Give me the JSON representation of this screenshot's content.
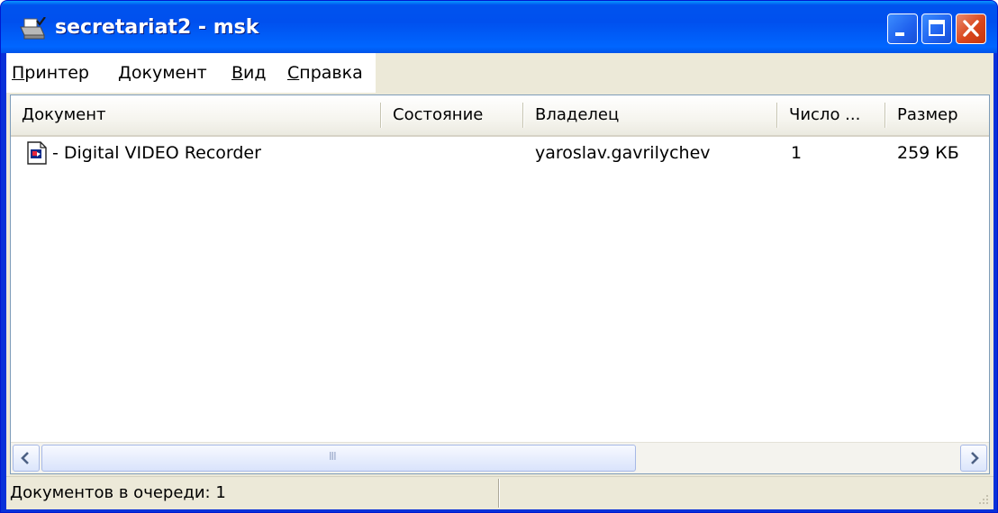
{
  "window": {
    "title": "secretariat2 - msk",
    "icon": "printer-icon"
  },
  "menu": [
    {
      "mnemonic": "П",
      "rest": "ринтер"
    },
    {
      "mnemonic": "Д",
      "rest": "окумент"
    },
    {
      "mnemonic": "В",
      "rest": "ид"
    },
    {
      "mnemonic": "С",
      "rest": "правка"
    }
  ],
  "columns": [
    "Документ",
    "Состояние",
    "Владелец",
    "Число ...",
    "Размер"
  ],
  "jobs": [
    {
      "document": " - Digital VIDEO Recorder",
      "status": "",
      "owner": "yaroslav.gavrilychev",
      "pages": "1",
      "size": "259 КБ",
      "icon": "document-icon"
    }
  ],
  "scrollbar": {
    "grip_text": "III"
  },
  "status": {
    "queue_text": "Документов в очереди: 1"
  }
}
